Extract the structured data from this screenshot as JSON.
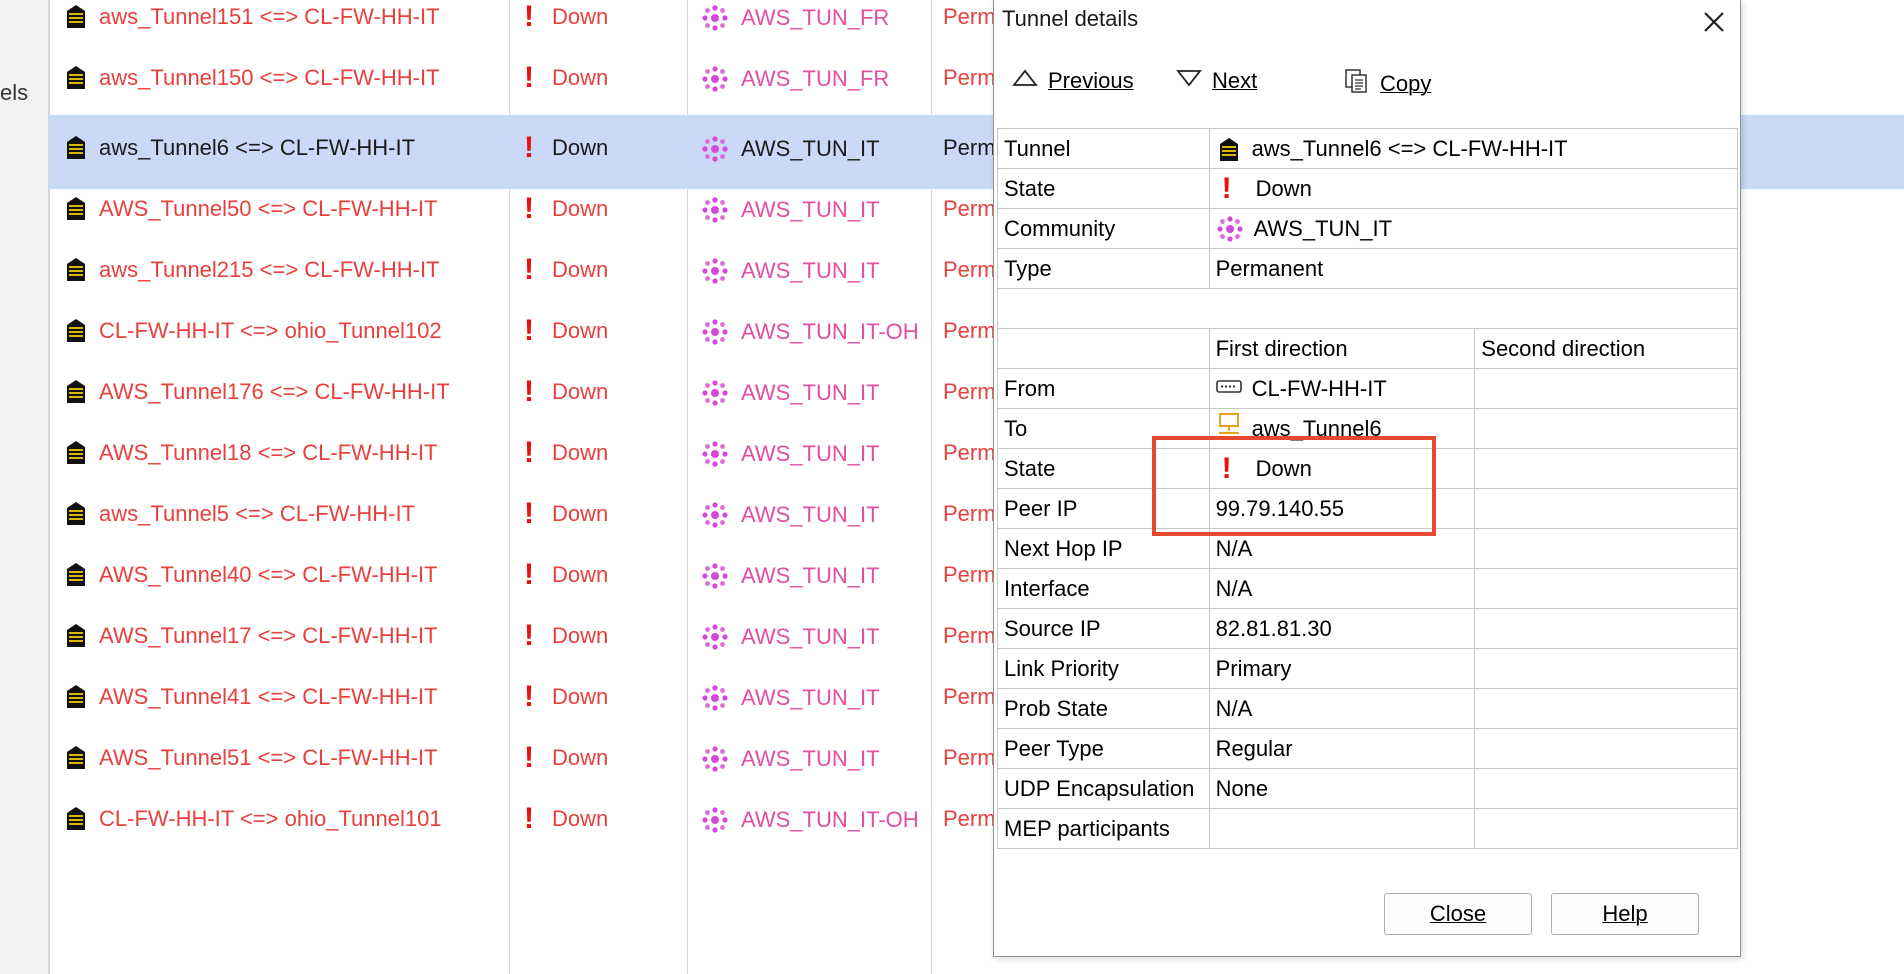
{
  "left_panel": {
    "cut_label": "els"
  },
  "tunnel_list": {
    "rows": [
      {
        "name": "aws_Tunnel151 <=> CL-FW-HH-IT",
        "state": "Down",
        "community": "AWS_TUN_FR",
        "type": "Perm",
        "selected": false
      },
      {
        "name": "aws_Tunnel150 <=> CL-FW-HH-IT",
        "state": "Down",
        "community": "AWS_TUN_FR",
        "type": "Perm",
        "selected": false
      },
      {
        "name": "aws_Tunnel6 <=> CL-FW-HH-IT",
        "state": "Down",
        "community": "AWS_TUN_IT",
        "type": "Perm",
        "selected": true
      },
      {
        "name": "AWS_Tunnel50 <=> CL-FW-HH-IT",
        "state": "Down",
        "community": "AWS_TUN_IT",
        "type": "Perm",
        "selected": false
      },
      {
        "name": "aws_Tunnel215 <=> CL-FW-HH-IT",
        "state": "Down",
        "community": "AWS_TUN_IT",
        "type": "Perm",
        "selected": false
      },
      {
        "name": "CL-FW-HH-IT <=> ohio_Tunnel102",
        "state": "Down",
        "community": "AWS_TUN_IT-OH",
        "type": "Perm",
        "selected": false
      },
      {
        "name": "AWS_Tunnel176 <=> CL-FW-HH-IT",
        "state": "Down",
        "community": "AWS_TUN_IT",
        "type": "Perm",
        "selected": false
      },
      {
        "name": "AWS_Tunnel18 <=> CL-FW-HH-IT",
        "state": "Down",
        "community": "AWS_TUN_IT",
        "type": "Perm",
        "selected": false
      },
      {
        "name": "aws_Tunnel5 <=> CL-FW-HH-IT",
        "state": "Down",
        "community": "AWS_TUN_IT",
        "type": "Perm",
        "selected": false
      },
      {
        "name": "AWS_Tunnel40 <=> CL-FW-HH-IT",
        "state": "Down",
        "community": "AWS_TUN_IT",
        "type": "Perm",
        "selected": false
      },
      {
        "name": "AWS_Tunnel17 <=> CL-FW-HH-IT",
        "state": "Down",
        "community": "AWS_TUN_IT",
        "type": "Perm",
        "selected": false
      },
      {
        "name": "AWS_Tunnel41 <=> CL-FW-HH-IT",
        "state": "Down",
        "community": "AWS_TUN_IT",
        "type": "Perm",
        "selected": false
      },
      {
        "name": "AWS_Tunnel51 <=> CL-FW-HH-IT",
        "state": "Down",
        "community": "AWS_TUN_IT",
        "type": "Perm",
        "selected": false
      },
      {
        "name": "CL-FW-HH-IT <=> ohio_Tunnel101",
        "state": "Down",
        "community": "AWS_TUN_IT-OH",
        "type": "Permanent",
        "selected": false
      }
    ]
  },
  "dialog": {
    "title": "Tunnel details",
    "toolbar": {
      "previous": "Previous",
      "next": "Next",
      "copy": "Copy"
    },
    "summary": [
      {
        "label": "Tunnel",
        "value": "aws_Tunnel6 <=> CL-FW-HH-IT",
        "icon": "gateway-lock-icon"
      },
      {
        "label": "State",
        "value": "Down",
        "icon": "exclamation-icon"
      },
      {
        "label": "Community",
        "value": "AWS_TUN_IT",
        "icon": "community-icon"
      },
      {
        "label": "Type",
        "value": "Permanent",
        "icon": ""
      }
    ],
    "direction_headers": {
      "first": "First direction",
      "second": "Second direction"
    },
    "details": [
      {
        "label": "From",
        "first": "CL-FW-HH-IT",
        "second": "",
        "icon": "firewall-device-icon"
      },
      {
        "label": "To",
        "first": "aws_Tunnel6",
        "second": "",
        "icon": "network-host-icon"
      },
      {
        "label": "State",
        "first": "Down",
        "second": "",
        "icon": "exclamation-icon"
      },
      {
        "label": "Peer IP",
        "first": "99.79.140.55",
        "second": "",
        "icon": ""
      },
      {
        "label": "Next Hop IP",
        "first": "N/A",
        "second": "",
        "icon": ""
      },
      {
        "label": "Interface",
        "first": "N/A",
        "second": "",
        "icon": ""
      },
      {
        "label": "Source IP",
        "first": "82.81.81.30",
        "second": "",
        "icon": ""
      },
      {
        "label": "Link Priority",
        "first": "Primary",
        "second": "",
        "icon": ""
      },
      {
        "label": "Prob State",
        "first": "N/A",
        "second": "",
        "icon": ""
      },
      {
        "label": "Peer Type",
        "first": "Regular",
        "second": "",
        "icon": ""
      },
      {
        "label": "UDP Encapsulation",
        "first": "None",
        "second": "",
        "icon": ""
      },
      {
        "label": "MEP participants",
        "first": "",
        "second": "",
        "icon": ""
      }
    ],
    "buttons": {
      "close": "Close",
      "help": "Help"
    }
  },
  "colors": {
    "down_text": "#e8403d",
    "community_text": "#e04fa0",
    "selected_row": "#cad9f7",
    "highlight_box": "#e64a2e"
  }
}
